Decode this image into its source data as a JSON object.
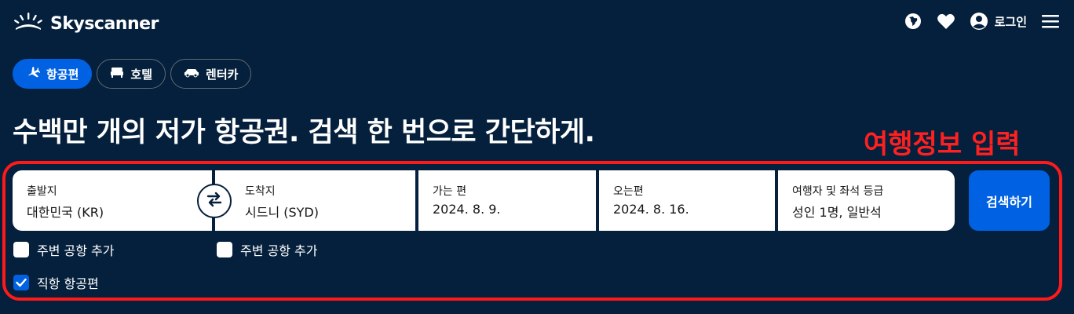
{
  "header": {
    "brand": "Skyscanner",
    "login_label": "로그인",
    "icons": [
      "globe-icon",
      "heart-icon",
      "user-icon",
      "menu-icon"
    ]
  },
  "tabs": [
    {
      "label": "항공편",
      "icon": "plane-icon",
      "active": true
    },
    {
      "label": "호텔",
      "icon": "bed-icon",
      "active": false
    },
    {
      "label": "렌터카",
      "icon": "car-icon",
      "active": false
    }
  ],
  "headline": "수백만 개의 저가 항공권. 검색 한 번으로 간단하게.",
  "annotation": {
    "label": "여행정보 입력",
    "color": "#ff1a1a"
  },
  "search_form": {
    "origin": {
      "label": "출발지",
      "value": "대한민국 (KR)"
    },
    "destination": {
      "label": "도착지",
      "value": "시드니 (SYD)"
    },
    "depart": {
      "label": "가는 편",
      "value": "2024. 8. 9."
    },
    "return": {
      "label": "오는편",
      "value": "2024. 8. 16."
    },
    "travellers": {
      "label": "여행자 및 좌석 등급",
      "value": "성인 1명, 일반석"
    },
    "search_button": "검색하기"
  },
  "options": {
    "origin_nearby": {
      "label": "주변 공항 추가",
      "checked": false
    },
    "dest_nearby": {
      "label": "주변 공항 추가",
      "checked": false
    },
    "direct_only": {
      "label": "직항 항공편",
      "checked": true
    }
  },
  "colors": {
    "background": "#05203c",
    "accent": "#0062e3"
  }
}
